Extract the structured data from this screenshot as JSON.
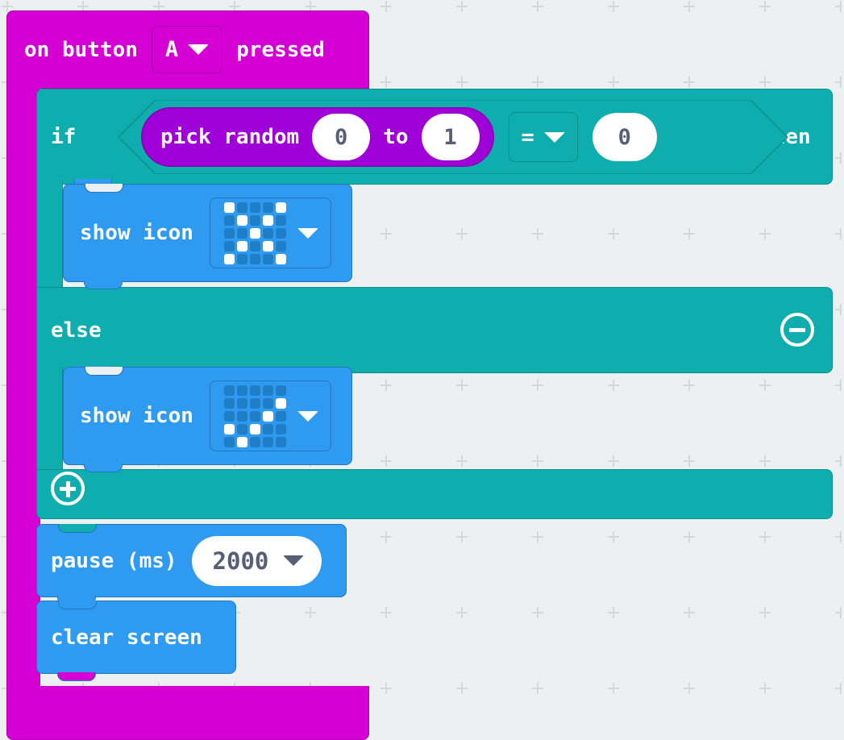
{
  "workspace": {
    "background_color": "#ecf0f1",
    "grid_mark": "+"
  },
  "palette": {
    "event_block": "#d400d4",
    "logic_block": "#0fadad",
    "math_block": "#a000d8",
    "basic_block": "#2e9bf0",
    "field_text": "#575e75"
  },
  "blocks": {
    "event": {
      "label_left": "on button",
      "button_value": "A",
      "label_right": "pressed",
      "dropdown_icon": "chevron-down-icon"
    },
    "conditional": {
      "if_label": "if",
      "then_label": "then",
      "else_label": "else",
      "remove_else_icon": "minus-circle-icon",
      "add_branch_icon": "plus-circle-icon",
      "condition": {
        "operator": "=",
        "operator_icon": "chevron-down-icon",
        "right_operand": "0",
        "left_reporter": {
          "label": "pick random",
          "from": "0",
          "to_label": "to",
          "to": "1"
        }
      }
    },
    "show_icon_true": {
      "label": "show icon",
      "icon_name": "no-icon-cross",
      "dropdown_icon": "chevron-down-icon",
      "matrix": [
        [
          1,
          0,
          0,
          0,
          1
        ],
        [
          0,
          1,
          0,
          1,
          0
        ],
        [
          0,
          0,
          1,
          0,
          0
        ],
        [
          0,
          1,
          0,
          1,
          0
        ],
        [
          1,
          0,
          0,
          0,
          1
        ]
      ]
    },
    "show_icon_false": {
      "label": "show icon",
      "icon_name": "yes-icon-check",
      "dropdown_icon": "chevron-down-icon",
      "matrix": [
        [
          0,
          0,
          0,
          0,
          0
        ],
        [
          0,
          0,
          0,
          0,
          1
        ],
        [
          0,
          0,
          0,
          1,
          0
        ],
        [
          1,
          0,
          1,
          0,
          0
        ],
        [
          0,
          1,
          0,
          0,
          0
        ]
      ]
    },
    "pause": {
      "label": "pause (ms)",
      "value": "2000",
      "dropdown_icon": "chevron-down-icon"
    },
    "clear_screen": {
      "label": "clear screen"
    }
  }
}
